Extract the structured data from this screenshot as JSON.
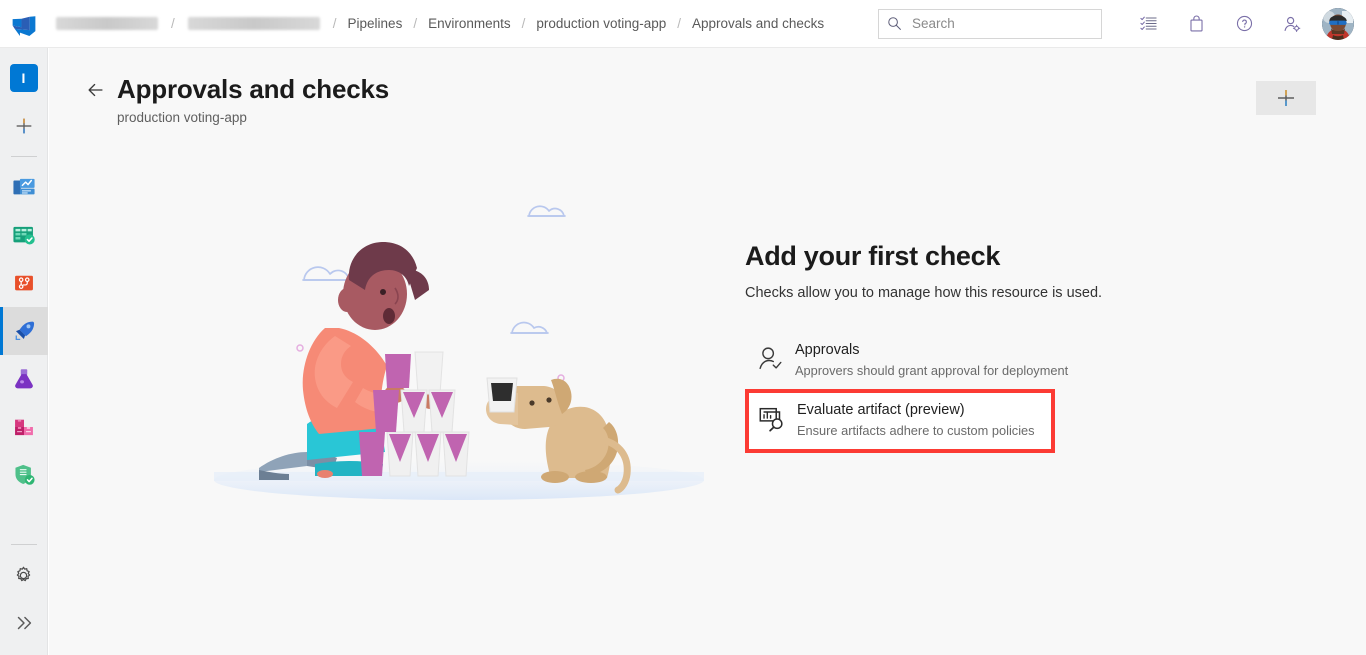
{
  "header": {
    "logo_icon": "azure-devops-logo",
    "breadcrumb": {
      "org_redacted": "",
      "project_redacted": "",
      "separator": "/",
      "items": [
        {
          "label": "Pipelines"
        },
        {
          "label": "Environments"
        },
        {
          "label": "production voting-app"
        },
        {
          "label": "Approvals and checks"
        }
      ]
    },
    "search": {
      "placeholder": "Search",
      "value": "",
      "icon": "search-icon"
    },
    "actions": [
      {
        "name": "tasks-icon",
        "label": "Tasks"
      },
      {
        "name": "marketplace-bag-icon",
        "label": "Marketplace"
      },
      {
        "name": "help-icon",
        "label": "Help"
      },
      {
        "name": "user-settings-icon",
        "label": "User settings"
      }
    ],
    "avatar": {
      "name": "avatar",
      "label": ""
    }
  },
  "sidebar": {
    "project_initial": "I",
    "items": [
      {
        "name": "project-tile",
        "label": "I",
        "selected": false
      },
      {
        "name": "new-item-button",
        "label": "",
        "icon": "plus-icon",
        "selected": false
      },
      {
        "name": "overview",
        "label": "Overview",
        "icon": "overview-icon",
        "selected": false
      },
      {
        "name": "boards",
        "label": "Boards",
        "icon": "boards-icon",
        "selected": false
      },
      {
        "name": "repos",
        "label": "Repos",
        "icon": "repos-icon",
        "selected": false
      },
      {
        "name": "pipelines",
        "label": "Pipelines",
        "icon": "pipelines-icon",
        "selected": true
      },
      {
        "name": "test-plans",
        "label": "Test Plans",
        "icon": "test-plans-icon",
        "selected": false
      },
      {
        "name": "artifacts",
        "label": "Artifacts",
        "icon": "artifacts-icon",
        "selected": false
      },
      {
        "name": "advanced-security",
        "label": "Advanced Security",
        "icon": "shield-check-icon",
        "selected": false
      }
    ],
    "bottom": [
      {
        "name": "project-settings",
        "label": "Project settings",
        "icon": "gear-icon"
      },
      {
        "name": "expand-sidebar",
        "label": "Expand",
        "icon": "double-chevron-right-icon"
      }
    ]
  },
  "page": {
    "back_icon": "back-arrow-icon",
    "title": "Approvals and checks",
    "subtitle": "production voting-app",
    "add_button": {
      "icon": "plus-icon",
      "label": ""
    }
  },
  "empty_state": {
    "title": "Add your first check",
    "subtitle": "Checks allow you to manage how this resource is used.",
    "illustration": "person-stacking-cups-with-dog",
    "checks": [
      {
        "icon": "person-check-icon",
        "title": "Approvals",
        "description": "Approvers should grant approval for deployment",
        "highlighted": false
      },
      {
        "icon": "evaluate-artifact-icon",
        "title": "Evaluate artifact (preview)",
        "description": "Ensure artifacts adhere to custom policies",
        "highlighted": true
      }
    ]
  },
  "colors": {
    "accent": "#0078d4",
    "highlight_red": "#fc3b34",
    "sidebar_bg": "#eff0f1",
    "main_bg": "#f8f8f8"
  }
}
